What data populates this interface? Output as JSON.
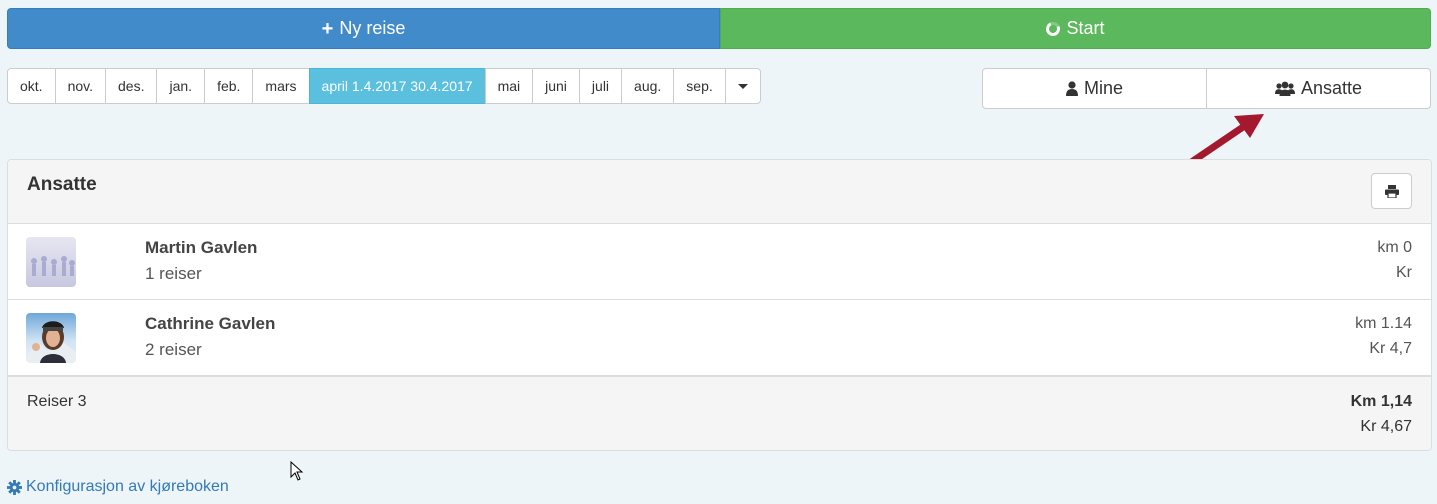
{
  "topbar": {
    "new_trip_label": "Ny reise",
    "start_label": "Start"
  },
  "months": [
    {
      "label": "okt.",
      "active": false
    },
    {
      "label": "nov.",
      "active": false
    },
    {
      "label": "des.",
      "active": false
    },
    {
      "label": "jan.",
      "active": false
    },
    {
      "label": "feb.",
      "active": false
    },
    {
      "label": "mars",
      "active": false
    },
    {
      "label": "april 1.4.2017 30.4.2017",
      "active": true
    },
    {
      "label": "mai",
      "active": false
    },
    {
      "label": "juni",
      "active": false
    },
    {
      "label": "juli",
      "active": false
    },
    {
      "label": "aug.",
      "active": false
    },
    {
      "label": "sep.",
      "active": false
    }
  ],
  "scope": {
    "mine_label": "Mine",
    "employees_label": "Ansatte"
  },
  "panel": {
    "title": "Ansatte",
    "rows": [
      {
        "name": "Martin Gavlen",
        "trips": "1 reiser",
        "km": "km 0",
        "kr": "Kr"
      },
      {
        "name": "Cathrine Gavlen",
        "trips": "2 reiser",
        "km": "km 1.14",
        "kr": "Kr 4,7"
      }
    ],
    "footer": {
      "total_trips": "Reiser 3",
      "total_km": "Km 1,14",
      "total_kr": "Kr 4,67"
    }
  },
  "config_link": "Konfigurasjon av kjøreboken",
  "colors": {
    "primary": "#428bca",
    "success": "#5cb85c",
    "info": "#5bc0de",
    "link": "#337ab7",
    "arrow": "#a5192f"
  }
}
